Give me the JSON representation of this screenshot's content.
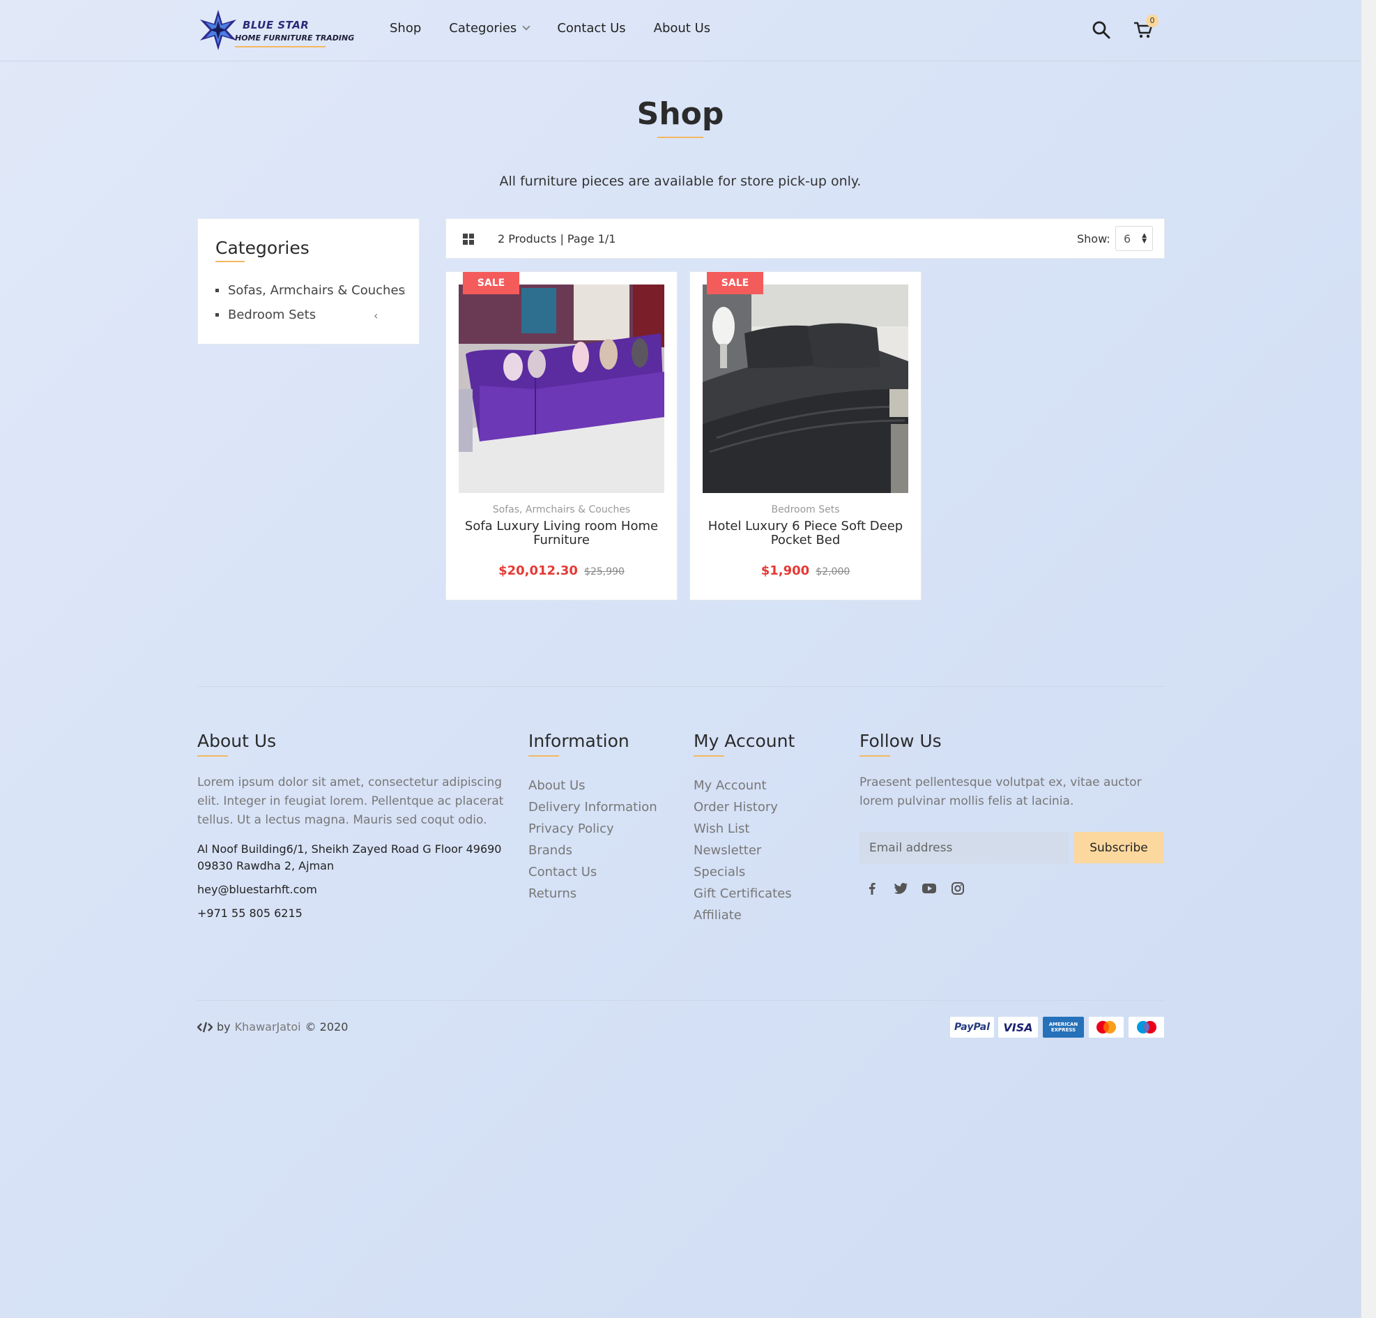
{
  "brand": {
    "name_line1": "BLUE STAR",
    "name_line2": "HOME FURNITURE TRADING"
  },
  "nav": {
    "items": [
      {
        "label": "Shop"
      },
      {
        "label": "Categories"
      },
      {
        "label": "Contact Us"
      },
      {
        "label": "About Us"
      }
    ],
    "cart_count": "0"
  },
  "page": {
    "title": "Shop",
    "subtitle": "All furniture pieces are available for store pick-up only."
  },
  "sidebar": {
    "title": "Categories",
    "items": [
      {
        "label": "Sofas, Armchairs & Couches"
      },
      {
        "label": "Bedroom Sets"
      }
    ]
  },
  "toolbar": {
    "count_text": "2 Products | Page 1/1",
    "show_label": "Show:",
    "show_value": "6"
  },
  "products": [
    {
      "badge": "SALE",
      "category": "Sofas, Armchairs & Couches",
      "name": "Sofa Luxury Living room Home Furniture",
      "price": "$20,012.30",
      "old_price": "$25,990"
    },
    {
      "badge": "SALE",
      "category": "Bedroom Sets",
      "name": "Hotel Luxury 6 Piece Soft Deep Pocket Bed",
      "price": "$1,900",
      "old_price": "$2,000"
    }
  ],
  "footer": {
    "about": {
      "title": "About Us",
      "text": "Lorem ipsum dolor sit amet, consectetur adipiscing elit. Integer in feugiat lorem. Pellentque ac placerat tellus. Ut a lectus magna. Mauris sed coqut odio.",
      "address": "Al Noof Building6/1, Sheikh Zayed Road G Floor 49690 09830 Rawdha 2, Ajman",
      "email": "hey@bluestarhft.com",
      "phone": "+971 55 805 6215"
    },
    "information": {
      "title": "Information",
      "links": [
        "About Us",
        "Delivery Information",
        "Privacy Policy",
        "Brands",
        "Contact Us",
        "Returns"
      ]
    },
    "account": {
      "title": "My Account",
      "links": [
        "My Account",
        "Order History",
        "Wish List",
        "Newsletter",
        "Specials",
        "Gift Certificates",
        "Affiliate"
      ]
    },
    "follow": {
      "title": "Follow Us",
      "text": "Praesent pellentesque volutpat ex, vitae auctor lorem pulvinar mollis felis at lacinia.",
      "email_placeholder": "Email address",
      "subscribe_label": "Subscribe",
      "socials": [
        "facebook-icon",
        "twitter-icon",
        "youtube-icon",
        "instagram-icon"
      ]
    },
    "copyright": {
      "prefix": "by",
      "author": "KhawarJatoi",
      "suffix": "© 2020"
    },
    "payments": [
      "PayPal",
      "VISA",
      "AMERICAN EXPRESS",
      "mastercard",
      "maestro"
    ]
  },
  "colors": {
    "accent": "#f4b860",
    "sale": "#f45b5b",
    "price": "#e53935",
    "brand": "#2b2a7a"
  }
}
